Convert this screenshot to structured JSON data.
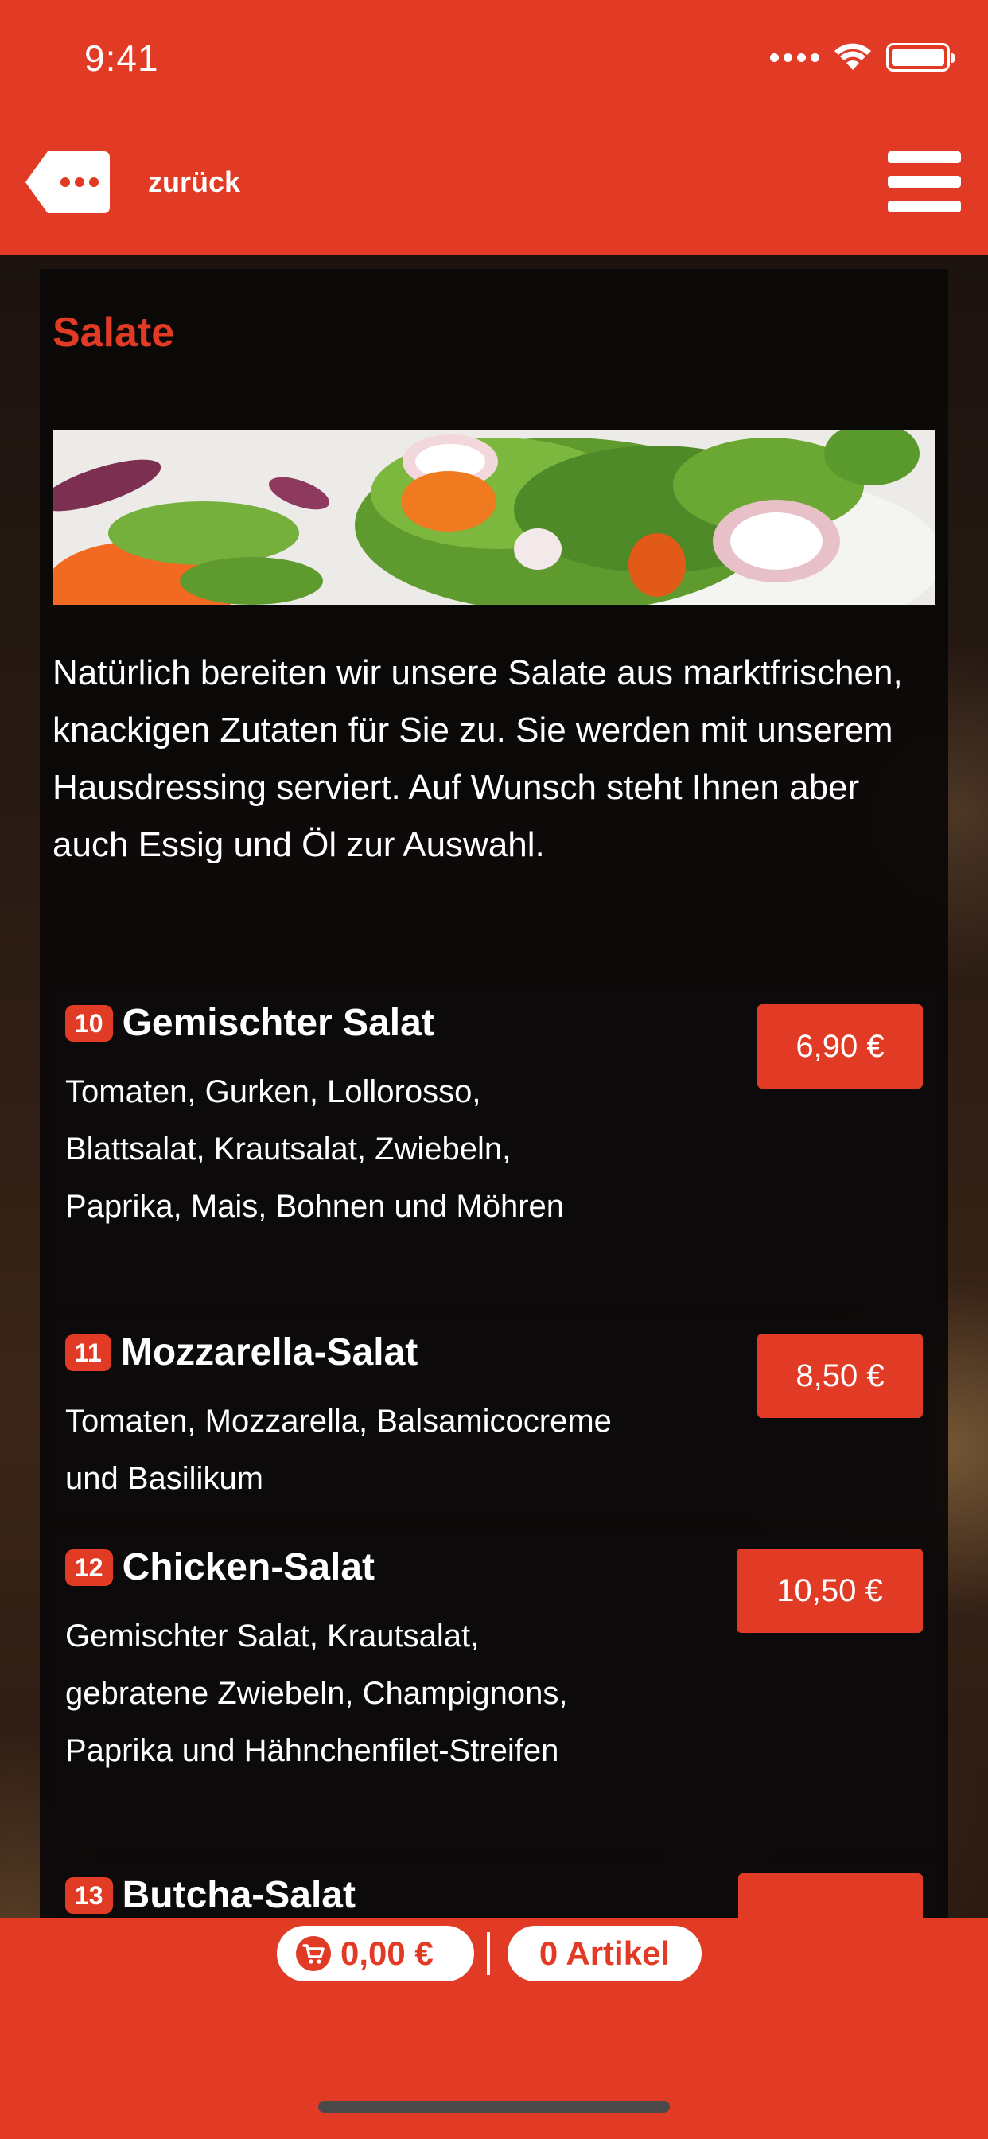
{
  "status_bar": {
    "time": "9:41"
  },
  "header": {
    "back_label": "zurück"
  },
  "section": {
    "title": "Salate",
    "intro": "Natürlich bereiten wir unsere Salate aus marktfrischen, knackigen Zutaten für Sie zu. Sie werden mit unserem Hausdressing serviert. Auf Wunsch steht Ihnen aber auch Essig und Öl zur Auswahl."
  },
  "items": [
    {
      "number": "10",
      "name": "Gemischter Salat",
      "description": "Tomaten, Gurken, Lollorosso, Blattsalat, Krautsalat, Zwiebeln, Paprika, Mais, Bohnen und Möhren",
      "price": "6,90 €"
    },
    {
      "number": "11",
      "name": "Mozzarella-Salat",
      "description": "Tomaten, Mozzarella, Balsamicocreme und Basilikum",
      "price": "8,50 €"
    },
    {
      "number": "12",
      "name": "Chicken-Salat",
      "description": "Gemischter Salat, Krautsalat, gebratene Zwiebeln, Champignons, Paprika und Hähnchenfilet-Streifen",
      "price": "10,50 €"
    },
    {
      "number": "13",
      "name": "Butcha-Salat",
      "description": "",
      "price": ""
    }
  ],
  "cart": {
    "amount": "0,00 €",
    "count_label": "0 Artikel"
  },
  "colors": {
    "brand_red": "#e13a25",
    "card_bg": "#0c0a0a",
    "text": "#ffffff"
  },
  "icons": [
    "back-tag-icon",
    "menu-icon",
    "cart-icon",
    "wifi-icon",
    "battery-icon",
    "signal-icon"
  ]
}
